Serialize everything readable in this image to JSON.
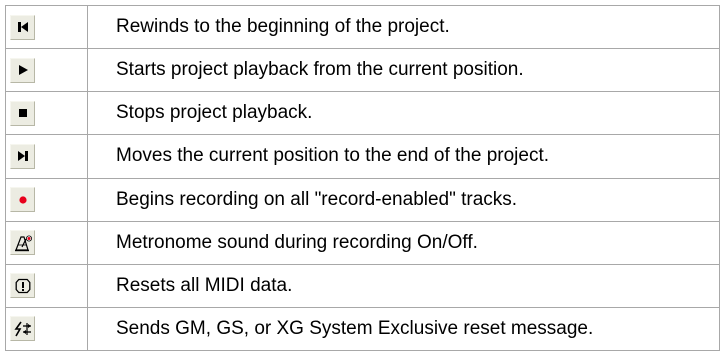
{
  "rows": [
    {
      "icon": "rewind-icon",
      "button": "rewind-button",
      "text": "Rewinds to the beginning of the project."
    },
    {
      "icon": "play-icon",
      "button": "play-button",
      "text": "Starts project playback from the current position."
    },
    {
      "icon": "stop-icon",
      "button": "stop-button",
      "text": "Stops project playback."
    },
    {
      "icon": "skip-to-end-icon",
      "button": "skip-to-end-button",
      "text": "Moves the current position to the end of the project."
    },
    {
      "icon": "record-icon",
      "button": "record-button",
      "text": "Begins recording on all \"record-enabled\" tracks."
    },
    {
      "icon": "metronome-icon",
      "button": "metronome-button",
      "text": "Metronome sound during recording On/Off."
    },
    {
      "icon": "midi-panic-icon",
      "button": "midi-reset-button",
      "text": "Resets all MIDI data."
    },
    {
      "icon": "sysex-reset-icon",
      "button": "sysex-reset-button",
      "text": "Sends GM, GS, or XG System Exclusive reset message."
    }
  ],
  "colors": {
    "border": "#a8a8a8",
    "button_face": "#ecece2",
    "record": "#e8001c",
    "icon": "#000000"
  }
}
